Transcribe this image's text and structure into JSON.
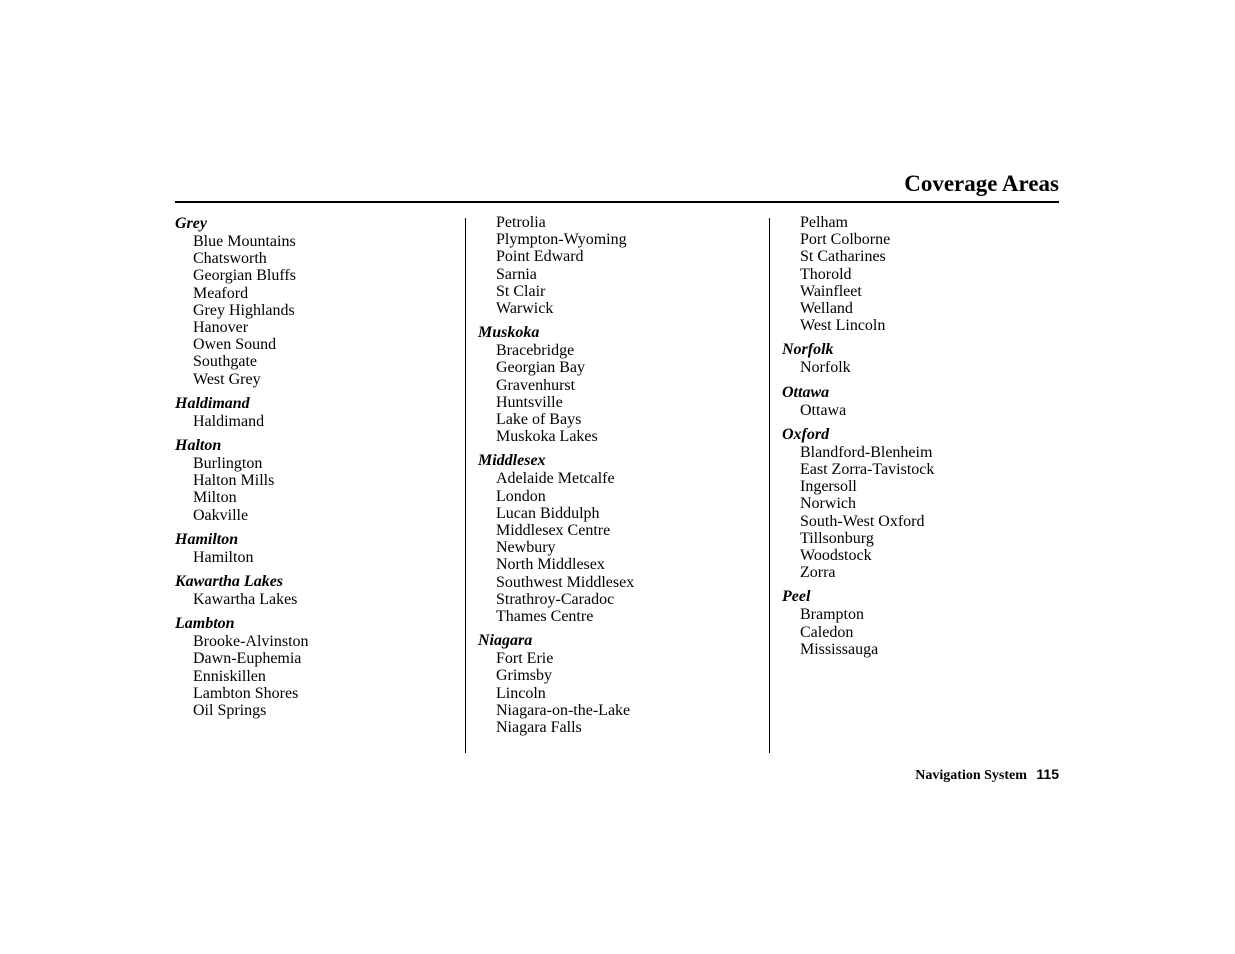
{
  "page": {
    "title": "Coverage Areas",
    "footer_label": "Navigation System",
    "page_number": "115"
  },
  "columns": [
    {
      "groups": [
        {
          "heading": "Grey",
          "items": [
            "Blue Mountains",
            "Chatsworth",
            "Georgian Bluffs",
            "Meaford",
            "Grey Highlands",
            "Hanover",
            "Owen Sound",
            "Southgate",
            "West Grey"
          ]
        },
        {
          "heading": "Haldimand",
          "items": [
            "Haldimand"
          ]
        },
        {
          "heading": "Halton",
          "items": [
            "Burlington",
            "Halton Mills",
            "Milton",
            "Oakville"
          ]
        },
        {
          "heading": "Hamilton",
          "items": [
            "Hamilton"
          ]
        },
        {
          "heading": "Kawartha Lakes",
          "items": [
            "Kawartha Lakes"
          ]
        },
        {
          "heading": "Lambton",
          "items": [
            "Brooke-Alvinston",
            "Dawn-Euphemia",
            "Enniskillen",
            "Lambton Shores",
            "Oil Springs"
          ]
        }
      ]
    },
    {
      "groups": [
        {
          "heading": "",
          "items": [
            "Petrolia",
            "Plympton-Wyoming",
            "Point Edward",
            "Sarnia",
            "St Clair",
            "Warwick"
          ]
        },
        {
          "heading": "Muskoka",
          "items": [
            "Bracebridge",
            "Georgian Bay",
            "Gravenhurst",
            "Huntsville",
            "Lake of Bays",
            "Muskoka Lakes"
          ]
        },
        {
          "heading": "Middlesex",
          "items": [
            "Adelaide Metcalfe",
            "London",
            "Lucan Biddulph",
            "Middlesex Centre",
            "Newbury",
            "North Middlesex",
            "Southwest Middlesex",
            "Strathroy-Caradoc",
            "Thames Centre"
          ]
        },
        {
          "heading": "Niagara",
          "items": [
            "Fort Erie",
            "Grimsby",
            "Lincoln",
            "Niagara-on-the-Lake",
            "Niagara Falls"
          ]
        }
      ]
    },
    {
      "groups": [
        {
          "heading": "",
          "items": [
            "Pelham",
            "Port Colborne",
            "St Catharines",
            "Thorold",
            "Wainfleet",
            "Welland",
            "West Lincoln"
          ]
        },
        {
          "heading": "Norfolk",
          "items": [
            "Norfolk"
          ]
        },
        {
          "heading": "Ottawa",
          "items": [
            "Ottawa"
          ]
        },
        {
          "heading": "Oxford",
          "items": [
            "Blandford-Blenheim",
            "East Zorra-Tavistock",
            "Ingersoll",
            "Norwich",
            "South-West Oxford",
            "Tillsonburg",
            "Woodstock",
            "Zorra"
          ]
        },
        {
          "heading": "Peel",
          "items": [
            "Brampton",
            "Caledon",
            "Mississauga"
          ]
        }
      ]
    }
  ]
}
